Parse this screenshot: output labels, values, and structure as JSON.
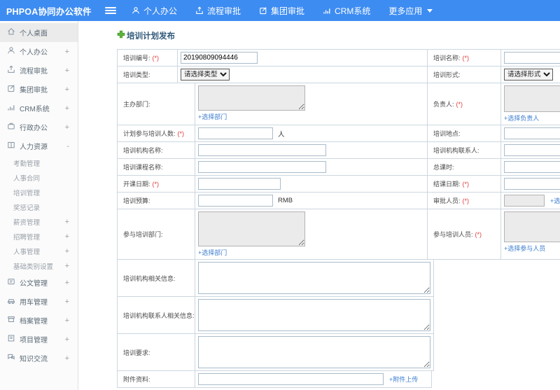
{
  "colors": {
    "topbar": "#3d8cf2",
    "link": "#3b7cd0",
    "required": "#e03c3c",
    "title": "#2f5879",
    "plus_icon": "#5cb43c"
  },
  "topbar": {
    "logo": "PHPOA协同办公软件",
    "nav": [
      {
        "icon": "user-icon",
        "label": "个人办公"
      },
      {
        "icon": "upload-icon",
        "label": "流程审批"
      },
      {
        "icon": "edit-icon",
        "label": "集团审批"
      },
      {
        "icon": "chart-icon",
        "label": "CRM系统"
      },
      {
        "icon": "caret-down-icon",
        "label": "更多应用"
      }
    ]
  },
  "sidebar": {
    "items": [
      {
        "label": "个人桌面",
        "expand": "",
        "icon": "home-icon",
        "active": true
      },
      {
        "label": "个人办公",
        "expand": "+",
        "icon": "user-icon"
      },
      {
        "label": "流程审批",
        "expand": "+",
        "icon": "upload-icon"
      },
      {
        "label": "集团审批",
        "expand": "+",
        "icon": "edit-icon"
      },
      {
        "label": "CRM系统",
        "expand": "+",
        "icon": "chart-icon"
      },
      {
        "label": "行政办公",
        "expand": "+",
        "icon": "briefcase-icon"
      },
      {
        "label": "人力资源",
        "expand": "-",
        "icon": "book-icon"
      }
    ],
    "hr_children": [
      {
        "label": "考勤管理",
        "expand": ""
      },
      {
        "label": "人事合同",
        "expand": ""
      },
      {
        "label": "培训管理",
        "expand": ""
      },
      {
        "label": "奖惩记录",
        "expand": ""
      },
      {
        "label": "薪资管理",
        "expand": "+"
      },
      {
        "label": "招聘管理",
        "expand": "+"
      },
      {
        "label": "人事管理",
        "expand": "+"
      },
      {
        "label": "基础类别设置",
        "expand": "+"
      }
    ],
    "items_bottom": [
      {
        "label": "公文管理",
        "expand": "+",
        "icon": "document-icon"
      },
      {
        "label": "用车管理",
        "expand": "+",
        "icon": "car-icon"
      },
      {
        "label": "档案管理",
        "expand": "+",
        "icon": "archive-icon"
      },
      {
        "label": "项目管理",
        "expand": "+",
        "icon": "clipboard-icon"
      },
      {
        "label": "知识交流",
        "expand": "+",
        "icon": "chat-icon"
      }
    ]
  },
  "form": {
    "title": "培训计划发布",
    "required_mark": "(*)",
    "fields": {
      "number": {
        "label": "培训编号:",
        "value": "20190809094446",
        "required": true
      },
      "name": {
        "label": "培训名称:",
        "required": true
      },
      "type": {
        "label": "培训类型:",
        "selected": "请选择类型"
      },
      "mode": {
        "label": "培训形式:",
        "selected": "请选择形式"
      },
      "dept": {
        "label": "主办部门:",
        "link": "+选择部门"
      },
      "leader": {
        "label": "负责人:",
        "required": true,
        "link": "+选择负责人"
      },
      "count": {
        "label": "计划参与培训人数:",
        "required": true,
        "unit": "人"
      },
      "place": {
        "label": "培训地点:"
      },
      "org": {
        "label": "培训机构名称:"
      },
      "org_contact": {
        "label": "培训机构联系人:"
      },
      "course": {
        "label": "培训课程名称:"
      },
      "hours": {
        "label": "总课时:"
      },
      "start_date": {
        "label": "开课日期:",
        "required": true
      },
      "end_date": {
        "label": "结课日期:",
        "required": true
      },
      "budget": {
        "label": "培训预算:",
        "unit": "RMB"
      },
      "approver": {
        "label": "审批人员:",
        "required": true,
        "link": "+选择审批人"
      },
      "join_dept": {
        "label": "参与培训部门:",
        "link": "+选择部门"
      },
      "join_staff": {
        "label": "参与培训人员:",
        "required": true,
        "link": "+选择参与人员"
      },
      "org_info": {
        "label": "培训机构相关信息:"
      },
      "org_contact_info": {
        "label": "培训机构联系人相关信息:"
      },
      "requirement": {
        "label": "培训要求:"
      },
      "attachment": {
        "label": "附件资料:",
        "link": "+附件上传"
      }
    }
  }
}
